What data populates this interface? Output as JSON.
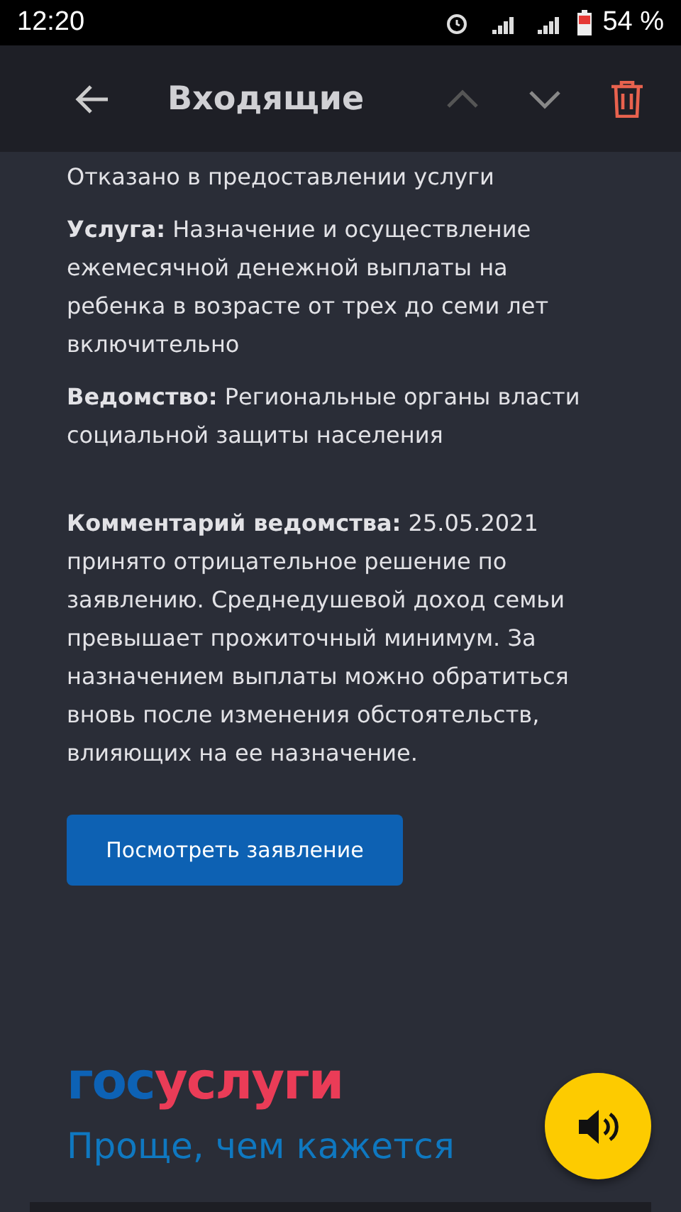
{
  "status_bar": {
    "time": "12:20",
    "battery": "54 %"
  },
  "header": {
    "title": "Входящие"
  },
  "status_line": "Отказано в предоставлении услуги",
  "fields": [
    {
      "label": "Услуга:",
      "value": "Назначение и осуществление ежемесячной денежной выплаты на ребенка в возрасте от трех до семи лет включительно"
    },
    {
      "label": "Ведомство:",
      "value": "Региональные органы власти социальной защиты населения"
    }
  ],
  "comment": {
    "label": "Комментарий ведомства:",
    "value": "25.05.2021 принято отрицательное решение по заявлению. Среднедушевой доход семьи превышает прожиточный минимум. За назначением выплаты можно обратиться вновь после изменения обстоятельств, влияющих на ее назначение."
  },
  "button": "Посмотреть заявление",
  "logo": {
    "first": "гос",
    "second": "услуги"
  },
  "tagline": "Проще, чем кажется"
}
